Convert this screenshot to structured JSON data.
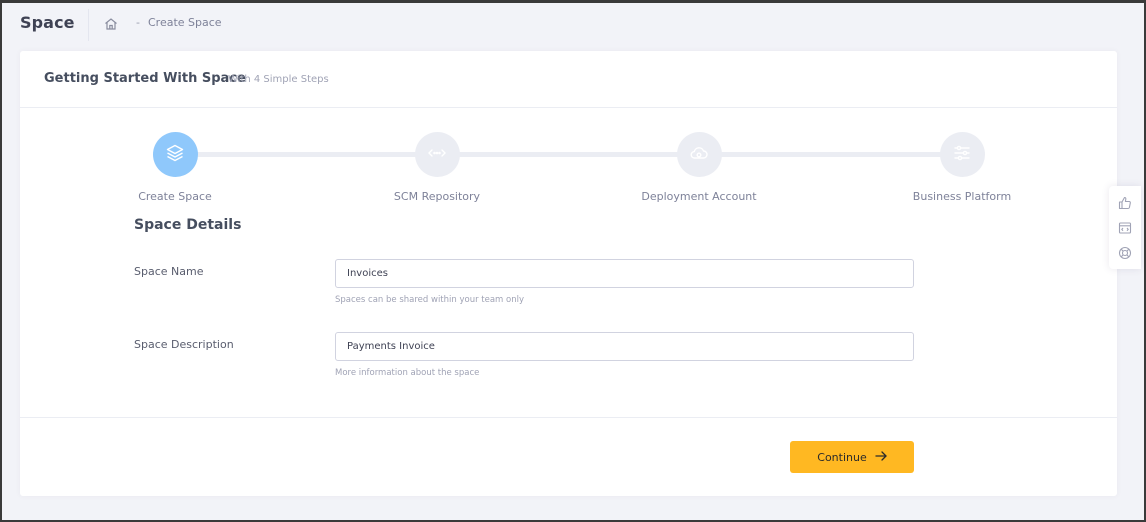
{
  "header": {
    "title": "Space",
    "breadcrumb_sep": "-",
    "breadcrumb": "Create Space"
  },
  "card": {
    "title": "Getting Started With Space",
    "subtitle": "With 4 Simple Steps"
  },
  "wizard": {
    "active_step": 0,
    "accent": "#8fc8fb",
    "steps": [
      {
        "label": "Create Space",
        "icon": "layers-icon"
      },
      {
        "label": "SCM Repository",
        "icon": "code-arrows-icon"
      },
      {
        "label": "Deployment Account",
        "icon": "cloud-settings-icon"
      },
      {
        "label": "Business Platform",
        "icon": "sliders-icon"
      }
    ]
  },
  "form": {
    "section_title": "Space Details",
    "space_name": {
      "label": "Space Name",
      "value": "Invoices",
      "help": "Spaces can be shared within your team only"
    },
    "space_description": {
      "label": "Space Description",
      "value": "Payments Invoice",
      "help": "More information about the space"
    }
  },
  "actions": {
    "continue_label": "Continue",
    "continue_color": "#ffb822"
  },
  "side_toolbar": {
    "icons": [
      "thumbs-up-icon",
      "code-window-icon",
      "lifebuoy-icon"
    ]
  }
}
